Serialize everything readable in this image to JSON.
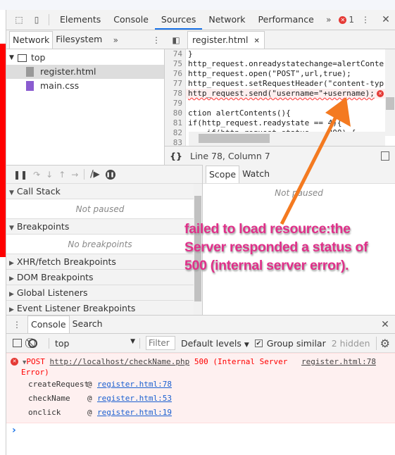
{
  "devtools": {
    "main_tabs": [
      "Elements",
      "Console",
      "Sources",
      "Network",
      "Performance"
    ],
    "active_tab": "Sources",
    "error_count": "1",
    "navigator_tabs": [
      "Network",
      "Filesystem"
    ],
    "tree": {
      "root": "top",
      "files": [
        "register.html",
        "main.css"
      ],
      "selected": "register.html"
    },
    "editor_tab": "register.html",
    "code_lines": [
      {
        "n": "74",
        "t": "}"
      },
      {
        "n": "75",
        "t": "http_request.onreadystatechange=alertConte"
      },
      {
        "n": "76",
        "t": "http_request.open(\"POST\",url,true);"
      },
      {
        "n": "77",
        "t": "http_request.setRequestHeader(\"content-typ"
      },
      {
        "n": "78",
        "t": "http_request.send(\"username=\"+username);"
      },
      {
        "n": "79",
        "t": ""
      },
      {
        "n": "80",
        "t": "ction alertContents(){"
      },
      {
        "n": "81",
        "t": "if(http_request.readystate == 4){"
      },
      {
        "n": "82",
        "t": "    if(http_request.status == 200) {"
      },
      {
        "n": "83",
        "t": ""
      }
    ],
    "status_text": "Line 78, Column 7",
    "sections": [
      {
        "label": "Call Stack",
        "expanded": true,
        "empty": "Not paused"
      },
      {
        "label": "Breakpoints",
        "expanded": true,
        "empty": "No breakpoints"
      },
      {
        "label": "XHR/fetch Breakpoints",
        "expanded": false
      },
      {
        "label": "DOM Breakpoints",
        "expanded": false
      },
      {
        "label": "Global Listeners",
        "expanded": false
      },
      {
        "label": "Event Listener Breakpoints",
        "expanded": false
      }
    ],
    "scope_tabs": [
      "Scope",
      "Watch"
    ],
    "scope_empty": "Not paused",
    "drawer_tabs": [
      "Console",
      "Search"
    ],
    "console_toolbar": {
      "context": "top",
      "filter_placeholder": "Filter",
      "levels": "Default levels",
      "group_similar": "Group similar",
      "group_similar_checked": true,
      "hidden": "2 hidden"
    },
    "error": {
      "method": "POST",
      "url": "http://localhost/checkName.php",
      "message": "500 (Internal Server",
      "message2": "Error)",
      "source": "register.html:78",
      "stack": [
        {
          "fn": "createRequest",
          "at": "@",
          "loc": "register.html:78"
        },
        {
          "fn": "checkName",
          "at": "@",
          "loc": "register.html:53"
        },
        {
          "fn": "onclick",
          "at": "@",
          "loc": "register.html:19"
        }
      ]
    },
    "prompt": "›"
  },
  "annotation": {
    "text": "failed to load resource:the Server responded a status of 500 (internal server error).",
    "color": "#e0308a",
    "arrow_color": "#f47a20"
  }
}
